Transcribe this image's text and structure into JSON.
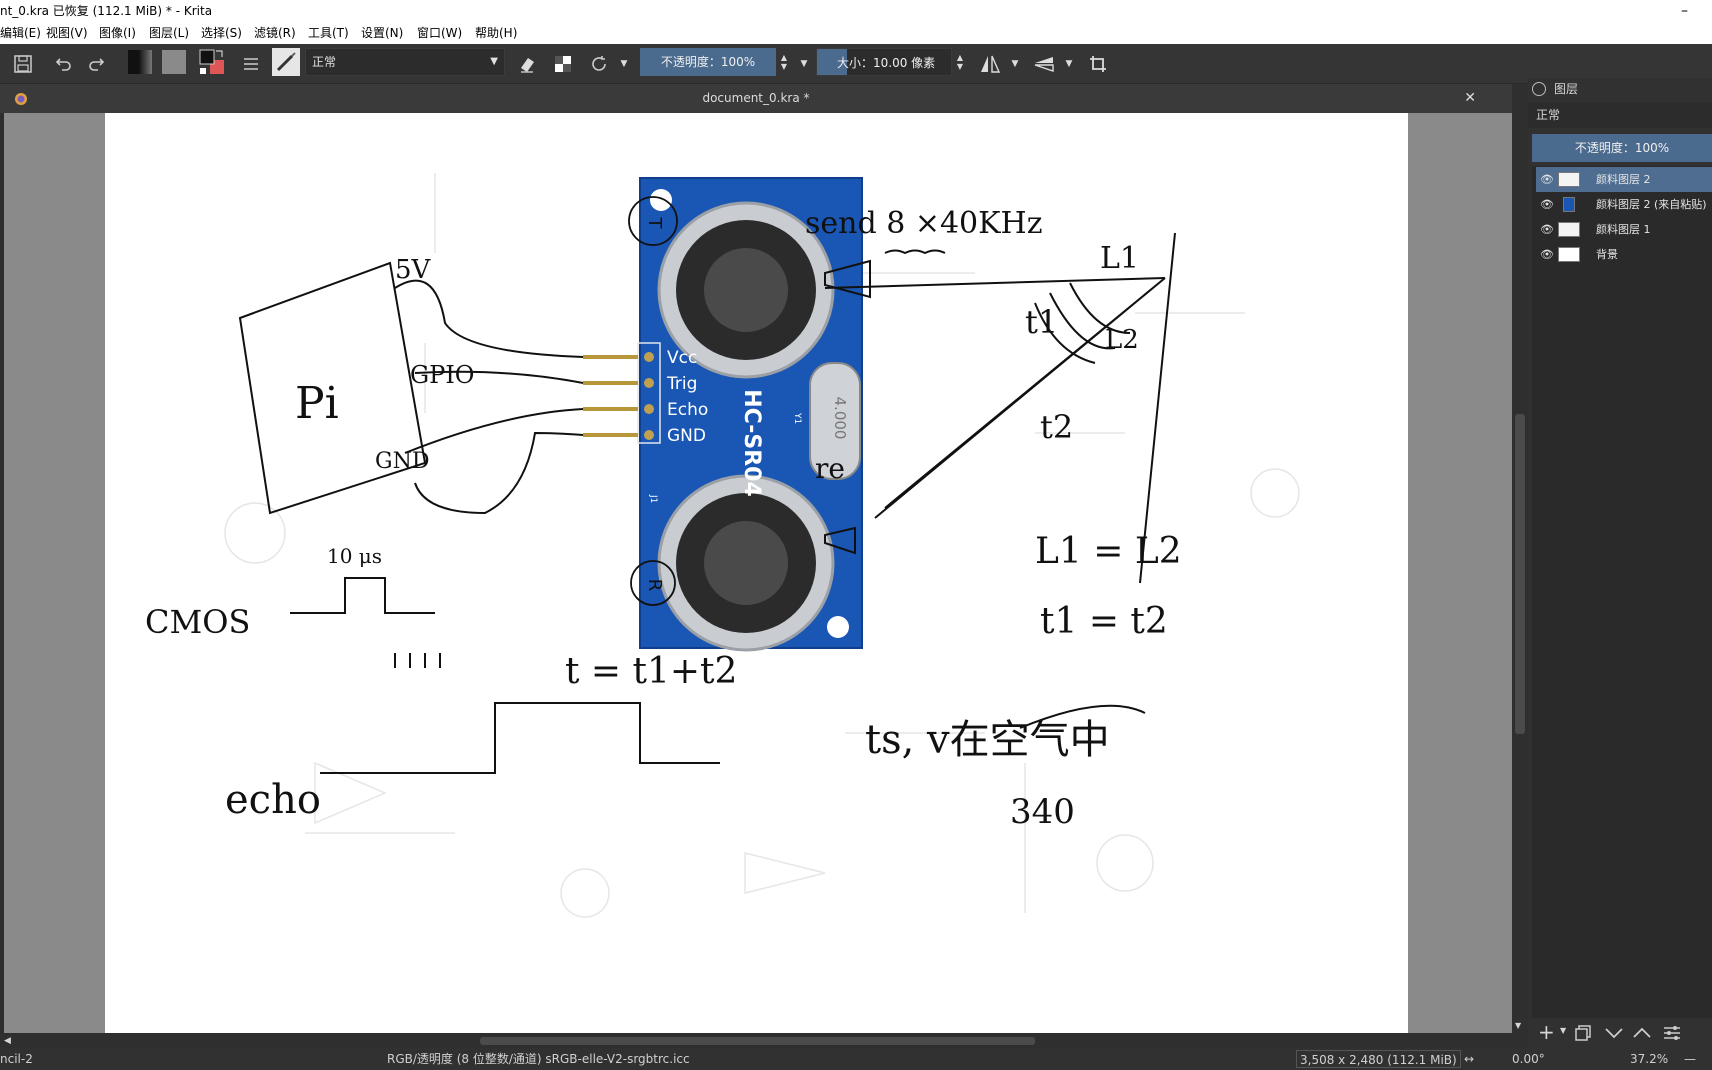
{
  "window": {
    "title": "nt_0.kra 已恢复  (112.1 MiB)  * - Krita",
    "minimize_glyph": "–"
  },
  "menu": [
    "编辑(E)",
    "视图(V)",
    "图像(I)",
    "图层(L)",
    "选择(S)",
    "滤镜(R)",
    "工具(T)",
    "设置(N)",
    "窗口(W)",
    "帮助(H)"
  ],
  "toolbar": {
    "blend_mode": "正常",
    "opacity_label": "不透明度：100%",
    "size_label": "大小：10.00 像素"
  },
  "document": {
    "tab_title": "document_0.kra *",
    "close_glyph": "✕"
  },
  "sketch": {
    "labels": [
      "send 8 ×40KHz",
      "L1",
      "t1",
      "L2",
      "t2",
      "re",
      "L1 = L2",
      "t1 = t2",
      "t = t1+t2",
      "ts, v在空气中",
      "340",
      "5V",
      "Pi",
      "GPIO",
      "GND",
      "10 μs",
      "CMOS",
      "echo"
    ],
    "sensor": {
      "pins": [
        "Vcc",
        "Trig",
        "Echo",
        "GND"
      ],
      "model": "HC-SR04",
      "crystal": "4.000",
      "crystal_ref": "Y1",
      "header_ref": "J1",
      "t_mark": "T",
      "r_mark": "R"
    }
  },
  "layers_panel": {
    "title": "图层",
    "blend_mode": "正常",
    "opacity": "不透明度：100%",
    "layers": [
      {
        "name": "颜料图层 2",
        "selected": true
      },
      {
        "name": "颜料图层 2 (来自粘贴)",
        "selected": false
      },
      {
        "name": "颜料图层 1",
        "selected": false
      },
      {
        "name": "背景",
        "selected": false
      }
    ]
  },
  "status": {
    "tool": "ncil-2",
    "color_space": "RGB/透明度 (8 位整数/通道)  sRGB-elle-V2-srgbtrc.icc",
    "image_size": "3,508 x 2,480 (112.1 MiB)",
    "rotation": "0.00°",
    "zoom": "37.2%"
  },
  "colors": {
    "accent": "#4a6a8e",
    "selected_layer": "#4f6d91",
    "panel": "#313131"
  }
}
